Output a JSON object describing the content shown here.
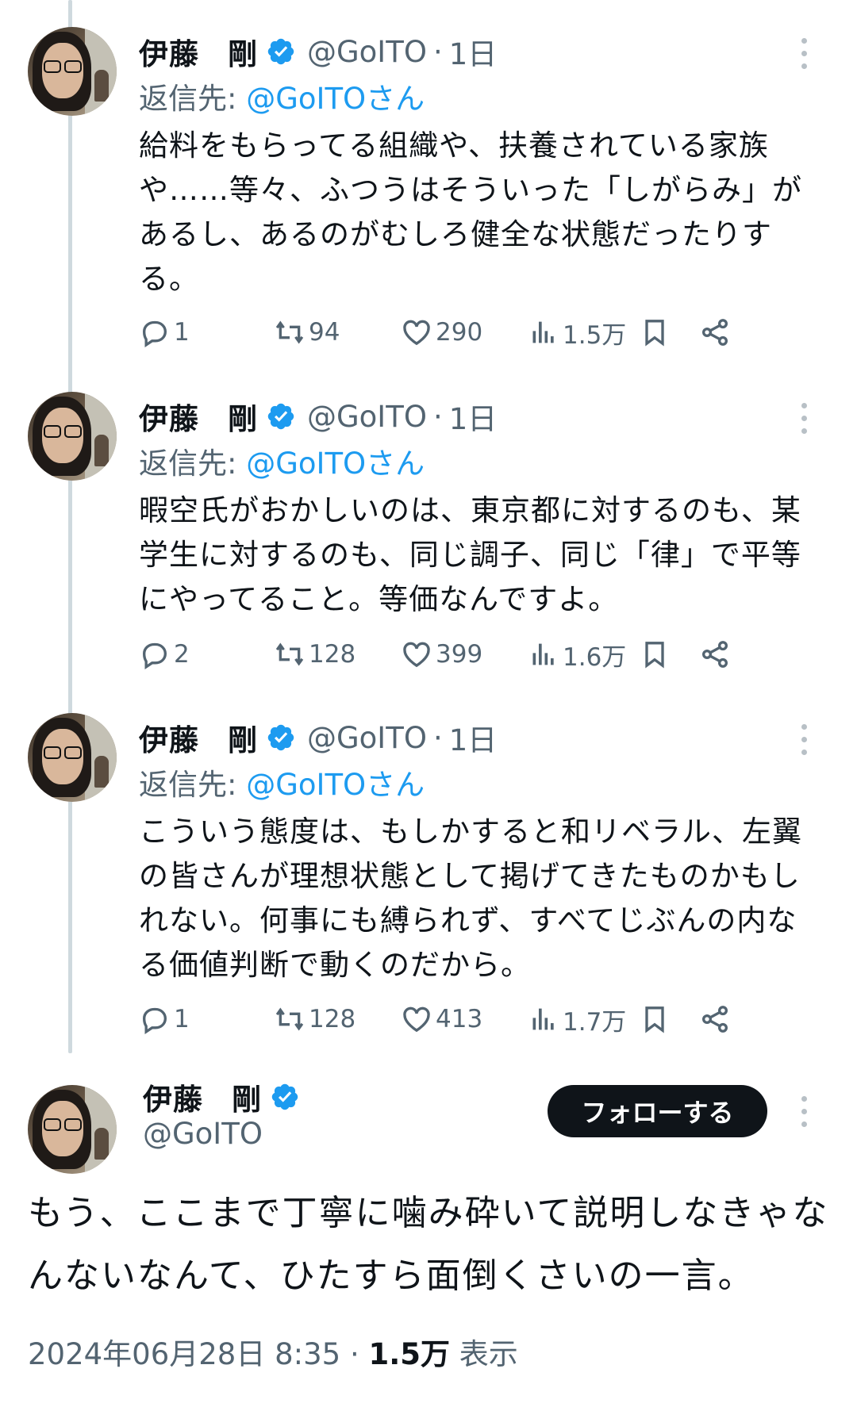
{
  "tweets": [
    {
      "name_last": "伊藤",
      "name_first": "剛",
      "handle": "@GoITO",
      "separator": "·",
      "time": "1日",
      "reply_prefix": "返信先: ",
      "reply_handle": "@GoITOさん",
      "text": "給料をもらってる組織や、扶養されている家族や……等々、ふつうはそういった「しがらみ」があるし、あるのがむしろ健全な状態だったりする。",
      "replies": "1",
      "retweets": "94",
      "likes": "290",
      "views": "1.5万"
    },
    {
      "name_last": "伊藤",
      "name_first": "剛",
      "handle": "@GoITO",
      "separator": "·",
      "time": "1日",
      "reply_prefix": "返信先: ",
      "reply_handle": "@GoITOさん",
      "text": "暇空氏がおかしいのは、東京都に対するのも、某学生に対するのも、同じ調子、同じ「律」で平等にやってること。等価なんですよ。",
      "replies": "2",
      "retweets": "128",
      "likes": "399",
      "views": "1.6万"
    },
    {
      "name_last": "伊藤",
      "name_first": "剛",
      "handle": "@GoITO",
      "separator": "·",
      "time": "1日",
      "reply_prefix": "返信先: ",
      "reply_handle": "@GoITOさん",
      "text": "こういう態度は、もしかすると和リベラル、左翼の皆さんが理想状態として掲げてきたものかもしれない。何事にも縛られず、すべてじぶんの内なる価値判断で動くのだから。",
      "replies": "1",
      "retweets": "128",
      "likes": "413",
      "views": "1.7万"
    }
  ],
  "main": {
    "name_last": "伊藤",
    "name_first": "剛",
    "handle": "@GoITO",
    "follow_label": "フォローする",
    "text": "もう、ここまで丁寧に噛み砕いて説明しなきゃなんないなんて、ひたすら面倒くさいの一言。",
    "date": "2024年06月28日 8:35",
    "separator": "·",
    "views": "1.5万",
    "views_label": "表示"
  },
  "colors": {
    "link": "#1d9bf0",
    "secondary": "#536471",
    "verified": "#1d9bf0",
    "button": "#0f1419"
  },
  "icons": [
    "verified-badge-icon",
    "reply-icon",
    "retweet-icon",
    "like-icon",
    "views-icon",
    "bookmark-icon",
    "share-icon",
    "more-icon"
  ]
}
